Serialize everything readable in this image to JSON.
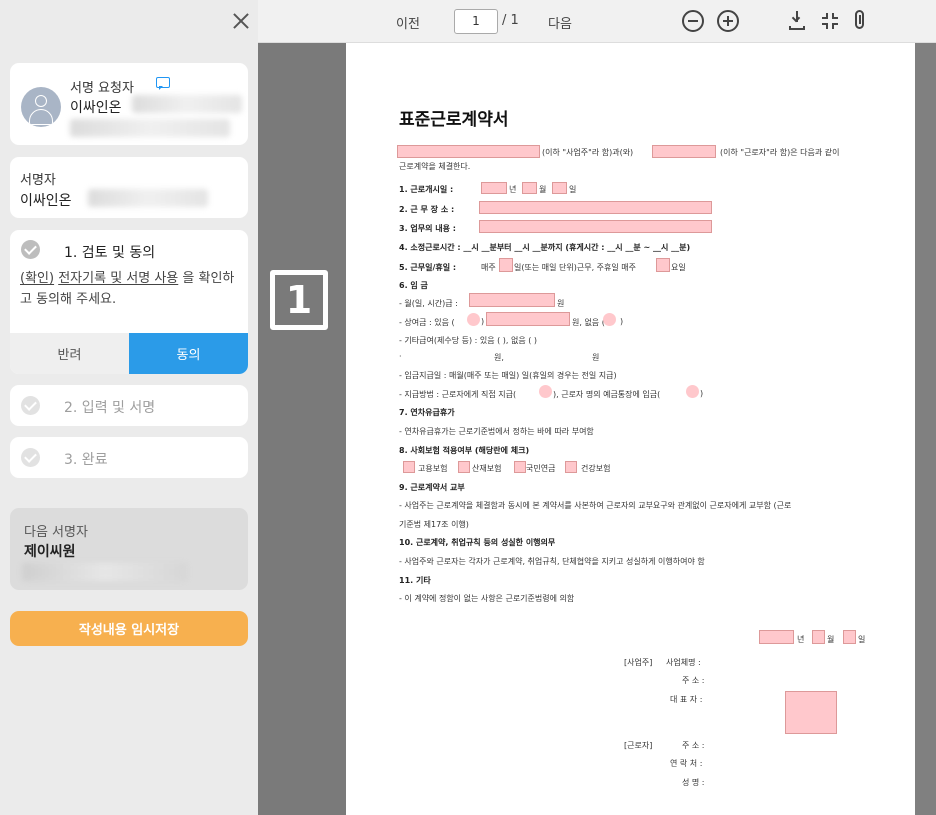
{
  "sidebar": {
    "requester_label": "서명 요청자",
    "requester_name": "이싸인온",
    "signer_label": "서명자",
    "signer_name": "이싸인온",
    "step1": {
      "title": "1. 검토 및 동의",
      "desc_link1": "(확인)",
      "desc_link2": "전자기록 및 서명 사용",
      "desc_rest": " 을 확인하고 동의해 주세요.",
      "reject": "반려",
      "agree": "동의"
    },
    "step2": "2. 입력 및 서명",
    "step3": "3. 완료",
    "next_label": "다음 서명자",
    "next_name": "제이씨원",
    "save": "작성내용 임시저장"
  },
  "toolbar": {
    "prev": "이전",
    "page": "1",
    "total": "/ 1",
    "next": "다음"
  },
  "viewer": {
    "thumb_number": "1"
  },
  "document": {
    "title": "표준근로계약서",
    "intro1": "(이하 \"사업주\"라 함)과(와)",
    "intro2": "(이하 \"근로자\"라 함)은 다음과 같이",
    "intro3": "근로계약을 체결한다.",
    "l1": "1.  근로개시일  :",
    "l1y": "년",
    "l1m": "월",
    "l1d": "일",
    "l2": "2.  근  무  장  소  :",
    "l3": "3.  업무의  내용  :",
    "l4": "4.  소정근로시간 :  __시 __분부터 __시 __분까지 (휴게시간 : __시 __분 ~ __시 __분)",
    "l5a": "5.  근무일/휴일  :",
    "l5b": "매주",
    "l5c": "일(또는 매일 단위)근무, 주휴일 매주",
    "l5d": "요일",
    "l6": "6.  임  금",
    "l6a": "- 월(일, 시간)급 :",
    "l6a2": "원",
    "l6b": "- 상여금 : 있음 (",
    "l6b2": ")",
    "l6b3": "원, 없음 (",
    "l6b4": ")",
    "l6c": "- 기타급여(제수당 등) : 있음 (    ), 없음 (    )",
    "l6d1": "·",
    "l6d2": "원,",
    "l6d3": "원",
    "l6e": "- 임금지급일 : 매월(매주 또는 매일)     일(휴일의 경우는 전일 지급)",
    "l6f": "- 지급방법 : 근로자에게 직접 지급(",
    "l6f2": "),   근로자 명의 예금통장에 입금(",
    "l6f3": ")",
    "l7": "7.  연차유급휴가",
    "l7a": "- 연차유급휴가는 근로기준법에서 정하는 바에 따라 부여함",
    "l8": "8.  사회보험 적용여부 (해당란에 체크)",
    "l8a": "고용보험",
    "l8b": "산재보험",
    "l8c": "국민연금",
    "l8d": "건강보험",
    "l9": "9.  근로계약서 교부",
    "l9a": "- 사업주는 근로계약을 체결함과 동시에 본 계약서를 사본하여 근로자의 교부요구와 관계없이 근로자에게 교부함 (근로",
    "l9b": "기준법 제17조 이행)",
    "l10": "10.  근로계약, 취업규칙 등의 성실한 이행의무",
    "l10a": "- 사업주와 근로자는 각자가 근로계약, 취업규칙, 단체협약을 지키고 성실하게 이행하여야 함",
    "l11": "11.  기타",
    "l11a": "- 이 계약에 정함이 없는 사항은 근로기준법령에 의함",
    "dy": "년",
    "dm": "월",
    "dd": "일",
    "emp_tag": "[사업주]",
    "emp_name": "사업체명 :",
    "emp_addr": "주  소 :",
    "emp_rep": "대  표  자 :",
    "wk_tag": "[근로자]",
    "wk_addr": "주  소 :",
    "wk_tel": "연  락  처 :",
    "wk_name": "성  명 :"
  }
}
